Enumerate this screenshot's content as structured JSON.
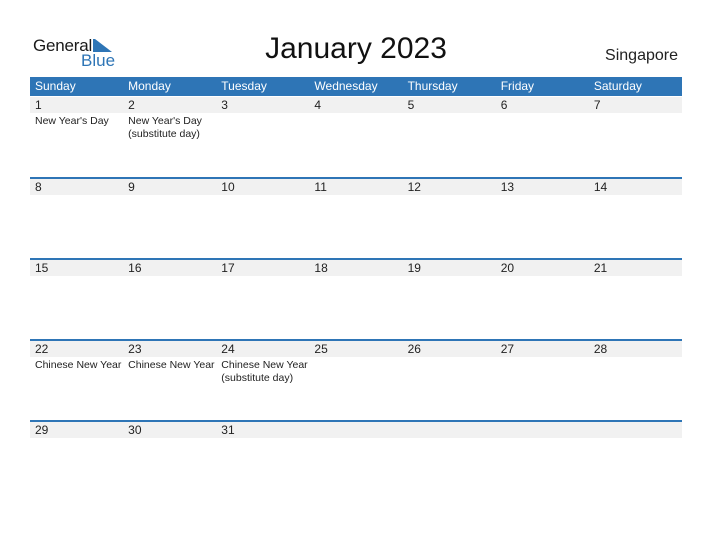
{
  "header": {
    "logo": {
      "word1": "General",
      "word2": "Blue"
    },
    "title": "January 2023",
    "country": "Singapore"
  },
  "colors": {
    "accent": "#2e75b6",
    "band": "#f1f1f1"
  },
  "weekdays": [
    "Sunday",
    "Monday",
    "Tuesday",
    "Wednesday",
    "Thursday",
    "Friday",
    "Saturday"
  ],
  "weeks": [
    [
      {
        "day": "1",
        "event": "New Year's Day"
      },
      {
        "day": "2",
        "event": "New Year's Day\n(substitute day)"
      },
      {
        "day": "3",
        "event": ""
      },
      {
        "day": "4",
        "event": ""
      },
      {
        "day": "5",
        "event": ""
      },
      {
        "day": "6",
        "event": ""
      },
      {
        "day": "7",
        "event": ""
      }
    ],
    [
      {
        "day": "8",
        "event": ""
      },
      {
        "day": "9",
        "event": ""
      },
      {
        "day": "10",
        "event": ""
      },
      {
        "day": "11",
        "event": ""
      },
      {
        "day": "12",
        "event": ""
      },
      {
        "day": "13",
        "event": ""
      },
      {
        "day": "14",
        "event": ""
      }
    ],
    [
      {
        "day": "15",
        "event": ""
      },
      {
        "day": "16",
        "event": ""
      },
      {
        "day": "17",
        "event": ""
      },
      {
        "day": "18",
        "event": ""
      },
      {
        "day": "19",
        "event": ""
      },
      {
        "day": "20",
        "event": ""
      },
      {
        "day": "21",
        "event": ""
      }
    ],
    [
      {
        "day": "22",
        "event": "Chinese New Year"
      },
      {
        "day": "23",
        "event": "Chinese New Year"
      },
      {
        "day": "24",
        "event": "Chinese New Year\n(substitute day)"
      },
      {
        "day": "25",
        "event": ""
      },
      {
        "day": "26",
        "event": ""
      },
      {
        "day": "27",
        "event": ""
      },
      {
        "day": "28",
        "event": ""
      }
    ],
    [
      {
        "day": "29",
        "event": ""
      },
      {
        "day": "30",
        "event": ""
      },
      {
        "day": "31",
        "event": ""
      },
      {
        "day": "",
        "event": ""
      },
      {
        "day": "",
        "event": ""
      },
      {
        "day": "",
        "event": ""
      },
      {
        "day": "",
        "event": ""
      }
    ]
  ]
}
